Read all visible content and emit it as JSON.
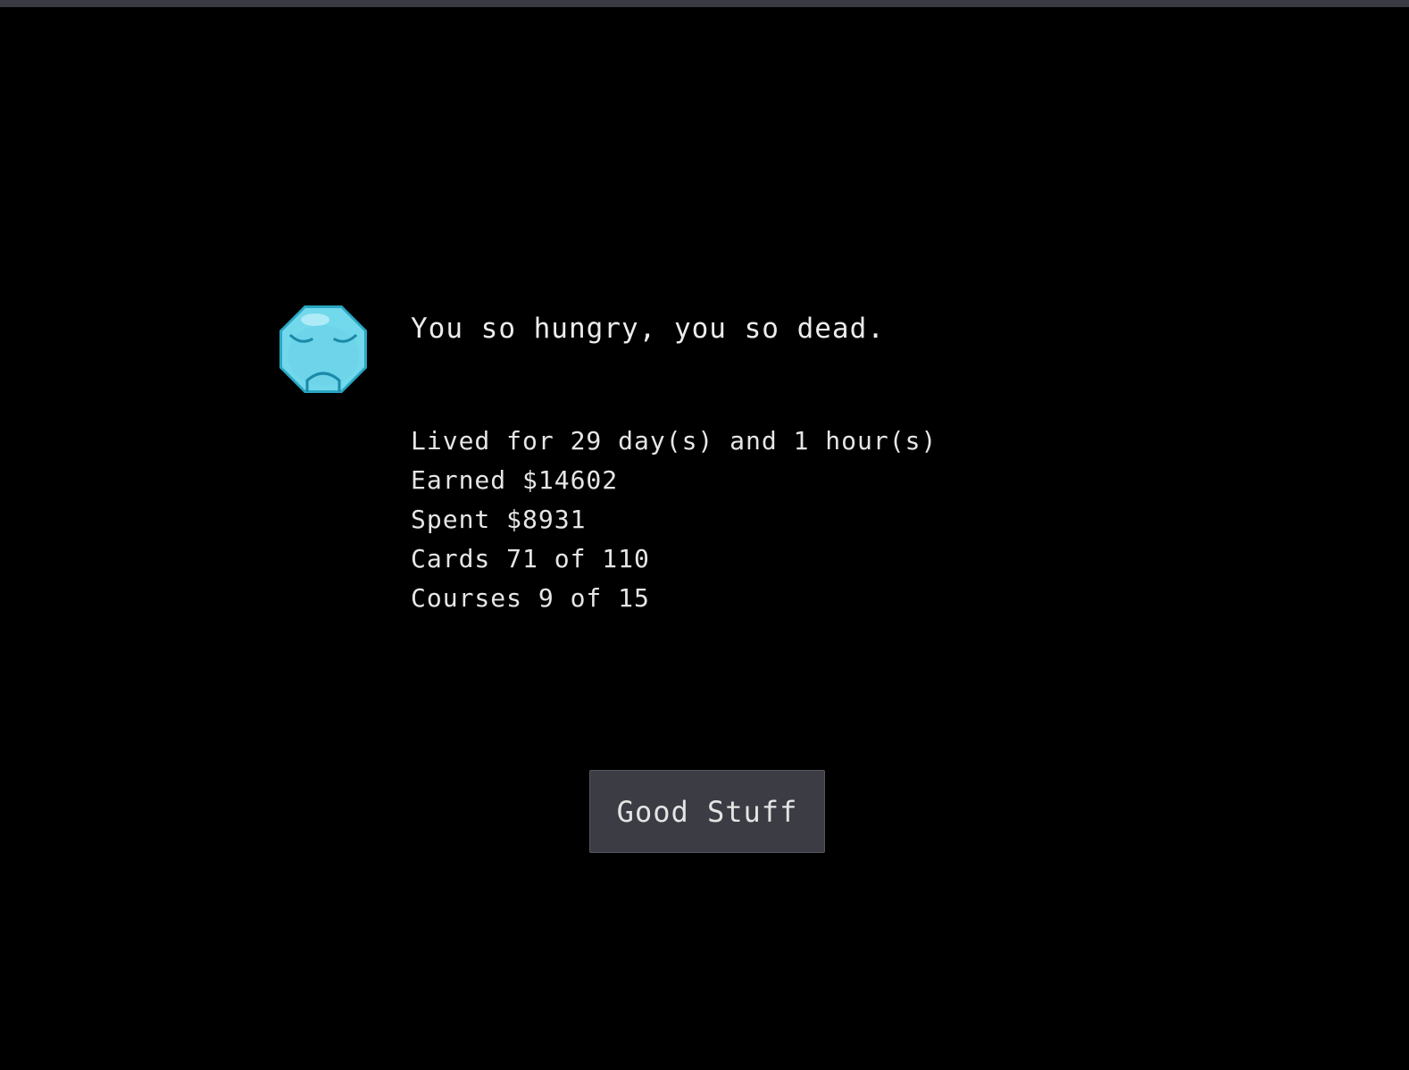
{
  "header": {
    "message": "You so hungry, you so dead."
  },
  "face_icon": {
    "name": "sad-face-icon",
    "color": "#6fd6ea",
    "outline": "#2aa6c4"
  },
  "stats": [
    {
      "label": "Lived for 29 day(s) and 1 hour(s)"
    },
    {
      "label": "Earned $14602"
    },
    {
      "label": "Spent $8931"
    },
    {
      "label": "Cards 71 of 110"
    },
    {
      "label": "Courses 9 of 15"
    }
  ],
  "actions": {
    "confirm_label": "Good Stuff"
  },
  "colors": {
    "background": "#000000",
    "top_bar": "#3a3b42",
    "text": "#e6e6e6",
    "button_bg": "#3b3c44"
  }
}
